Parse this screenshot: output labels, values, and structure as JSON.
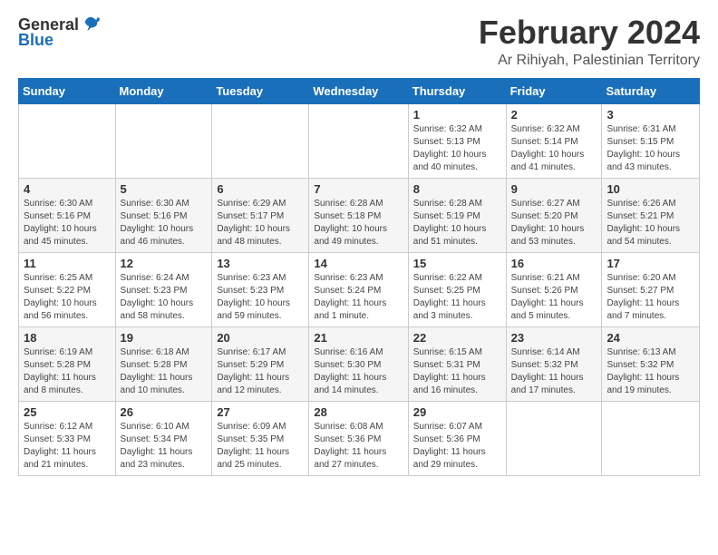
{
  "header": {
    "logo_general": "General",
    "logo_blue": "Blue",
    "month": "February 2024",
    "location": "Ar Rihiyah, Palestinian Territory"
  },
  "weekdays": [
    "Sunday",
    "Monday",
    "Tuesday",
    "Wednesday",
    "Thursday",
    "Friday",
    "Saturday"
  ],
  "weeks": [
    [
      {
        "day": "",
        "info": ""
      },
      {
        "day": "",
        "info": ""
      },
      {
        "day": "",
        "info": ""
      },
      {
        "day": "",
        "info": ""
      },
      {
        "day": "1",
        "info": "Sunrise: 6:32 AM\nSunset: 5:13 PM\nDaylight: 10 hours\nand 40 minutes."
      },
      {
        "day": "2",
        "info": "Sunrise: 6:32 AM\nSunset: 5:14 PM\nDaylight: 10 hours\nand 41 minutes."
      },
      {
        "day": "3",
        "info": "Sunrise: 6:31 AM\nSunset: 5:15 PM\nDaylight: 10 hours\nand 43 minutes."
      }
    ],
    [
      {
        "day": "4",
        "info": "Sunrise: 6:30 AM\nSunset: 5:16 PM\nDaylight: 10 hours\nand 45 minutes."
      },
      {
        "day": "5",
        "info": "Sunrise: 6:30 AM\nSunset: 5:16 PM\nDaylight: 10 hours\nand 46 minutes."
      },
      {
        "day": "6",
        "info": "Sunrise: 6:29 AM\nSunset: 5:17 PM\nDaylight: 10 hours\nand 48 minutes."
      },
      {
        "day": "7",
        "info": "Sunrise: 6:28 AM\nSunset: 5:18 PM\nDaylight: 10 hours\nand 49 minutes."
      },
      {
        "day": "8",
        "info": "Sunrise: 6:28 AM\nSunset: 5:19 PM\nDaylight: 10 hours\nand 51 minutes."
      },
      {
        "day": "9",
        "info": "Sunrise: 6:27 AM\nSunset: 5:20 PM\nDaylight: 10 hours\nand 53 minutes."
      },
      {
        "day": "10",
        "info": "Sunrise: 6:26 AM\nSunset: 5:21 PM\nDaylight: 10 hours\nand 54 minutes."
      }
    ],
    [
      {
        "day": "11",
        "info": "Sunrise: 6:25 AM\nSunset: 5:22 PM\nDaylight: 10 hours\nand 56 minutes."
      },
      {
        "day": "12",
        "info": "Sunrise: 6:24 AM\nSunset: 5:23 PM\nDaylight: 10 hours\nand 58 minutes."
      },
      {
        "day": "13",
        "info": "Sunrise: 6:23 AM\nSunset: 5:23 PM\nDaylight: 10 hours\nand 59 minutes."
      },
      {
        "day": "14",
        "info": "Sunrise: 6:23 AM\nSunset: 5:24 PM\nDaylight: 11 hours\nand 1 minute."
      },
      {
        "day": "15",
        "info": "Sunrise: 6:22 AM\nSunset: 5:25 PM\nDaylight: 11 hours\nand 3 minutes."
      },
      {
        "day": "16",
        "info": "Sunrise: 6:21 AM\nSunset: 5:26 PM\nDaylight: 11 hours\nand 5 minutes."
      },
      {
        "day": "17",
        "info": "Sunrise: 6:20 AM\nSunset: 5:27 PM\nDaylight: 11 hours\nand 7 minutes."
      }
    ],
    [
      {
        "day": "18",
        "info": "Sunrise: 6:19 AM\nSunset: 5:28 PM\nDaylight: 11 hours\nand 8 minutes."
      },
      {
        "day": "19",
        "info": "Sunrise: 6:18 AM\nSunset: 5:28 PM\nDaylight: 11 hours\nand 10 minutes."
      },
      {
        "day": "20",
        "info": "Sunrise: 6:17 AM\nSunset: 5:29 PM\nDaylight: 11 hours\nand 12 minutes."
      },
      {
        "day": "21",
        "info": "Sunrise: 6:16 AM\nSunset: 5:30 PM\nDaylight: 11 hours\nand 14 minutes."
      },
      {
        "day": "22",
        "info": "Sunrise: 6:15 AM\nSunset: 5:31 PM\nDaylight: 11 hours\nand 16 minutes."
      },
      {
        "day": "23",
        "info": "Sunrise: 6:14 AM\nSunset: 5:32 PM\nDaylight: 11 hours\nand 17 minutes."
      },
      {
        "day": "24",
        "info": "Sunrise: 6:13 AM\nSunset: 5:32 PM\nDaylight: 11 hours\nand 19 minutes."
      }
    ],
    [
      {
        "day": "25",
        "info": "Sunrise: 6:12 AM\nSunset: 5:33 PM\nDaylight: 11 hours\nand 21 minutes."
      },
      {
        "day": "26",
        "info": "Sunrise: 6:10 AM\nSunset: 5:34 PM\nDaylight: 11 hours\nand 23 minutes."
      },
      {
        "day": "27",
        "info": "Sunrise: 6:09 AM\nSunset: 5:35 PM\nDaylight: 11 hours\nand 25 minutes."
      },
      {
        "day": "28",
        "info": "Sunrise: 6:08 AM\nSunset: 5:36 PM\nDaylight: 11 hours\nand 27 minutes."
      },
      {
        "day": "29",
        "info": "Sunrise: 6:07 AM\nSunset: 5:36 PM\nDaylight: 11 hours\nand 29 minutes."
      },
      {
        "day": "",
        "info": ""
      },
      {
        "day": "",
        "info": ""
      }
    ]
  ]
}
